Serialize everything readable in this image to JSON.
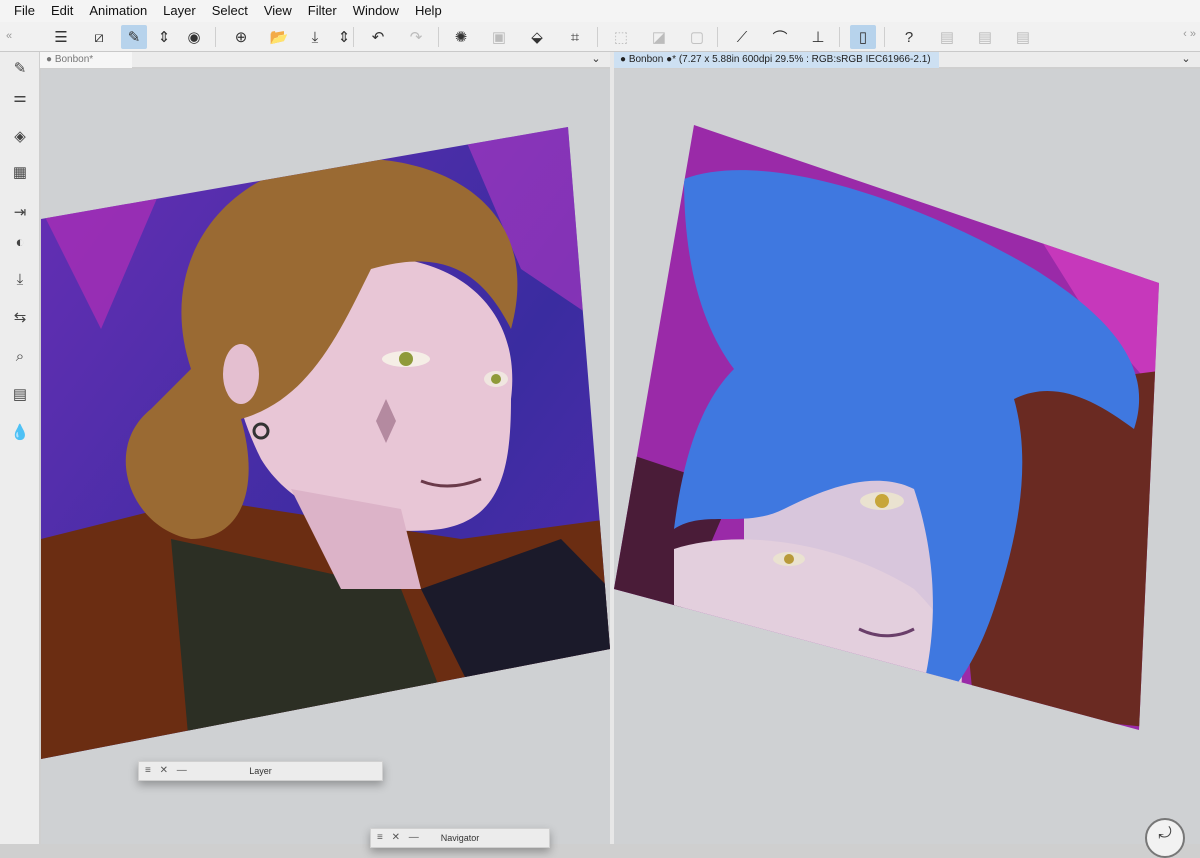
{
  "menubar": {
    "items": [
      {
        "id": "file",
        "label": "File"
      },
      {
        "id": "edit",
        "label": "Edit"
      },
      {
        "id": "animation",
        "label": "Animation"
      },
      {
        "id": "layer",
        "label": "Layer"
      },
      {
        "id": "select",
        "label": "Select"
      },
      {
        "id": "view",
        "label": "View"
      },
      {
        "id": "filter",
        "label": "Filter"
      },
      {
        "id": "window",
        "label": "Window"
      },
      {
        "id": "help",
        "label": "Help"
      }
    ]
  },
  "toolbar": {
    "buttons": [
      {
        "icon": "hamburger-menu-icon",
        "glyph": "☰",
        "active": false,
        "disabled": false
      },
      {
        "icon": "canvas-resize-icon",
        "glyph": "⧄",
        "active": false,
        "disabled": false
      },
      {
        "icon": "edit-tool-icon",
        "glyph": "✎",
        "active": true,
        "disabled": false
      },
      {
        "icon": "up-down-arrows-icon",
        "glyph": "⇕",
        "active": false,
        "disabled": false
      },
      {
        "icon": "record-icon",
        "glyph": "◉",
        "active": false,
        "disabled": false
      },
      {
        "icon": "new-canvas-icon",
        "glyph": "⊕",
        "active": false,
        "disabled": false
      },
      {
        "icon": "open-folder-icon",
        "glyph": "📂",
        "active": false,
        "disabled": false
      },
      {
        "icon": "save-icon",
        "glyph": "⤓",
        "active": false,
        "disabled": false
      },
      {
        "icon": "up-down-arrows-icon",
        "glyph": "⇕",
        "active": false,
        "disabled": false
      },
      {
        "icon": "undo-icon",
        "glyph": "↶",
        "active": false,
        "disabled": false
      },
      {
        "icon": "redo-icon",
        "glyph": "↷",
        "active": false,
        "disabled": true
      },
      {
        "icon": "loading-spinner-icon",
        "glyph": "✺",
        "active": false,
        "disabled": false
      },
      {
        "icon": "select-all-icon",
        "glyph": "▣",
        "active": false,
        "disabled": true
      },
      {
        "icon": "fill-bucket-icon",
        "glyph": "⬙",
        "active": false,
        "disabled": false
      },
      {
        "icon": "crop-icon",
        "glyph": "⌗",
        "active": false,
        "disabled": false
      },
      {
        "icon": "deselect-icon",
        "glyph": "⬚",
        "active": false,
        "disabled": true
      },
      {
        "icon": "invert-selection-icon",
        "glyph": "◪",
        "active": false,
        "disabled": true
      },
      {
        "icon": "selection-border-icon",
        "glyph": "▢",
        "active": false,
        "disabled": true
      },
      {
        "icon": "ruler-pen-icon",
        "glyph": "⟋",
        "active": false,
        "disabled": false
      },
      {
        "icon": "brush-icon",
        "glyph": "⌒",
        "active": false,
        "disabled": false
      },
      {
        "icon": "straight-line-icon",
        "glyph": "⊥",
        "active": false,
        "disabled": false
      },
      {
        "icon": "device-icon",
        "glyph": "▯",
        "active": true,
        "disabled": false
      },
      {
        "icon": "help-icon",
        "glyph": "?",
        "active": false,
        "disabled": false
      },
      {
        "icon": "clipboard-icon",
        "glyph": "▤",
        "active": false,
        "disabled": true
      },
      {
        "icon": "clipboard-icon",
        "glyph": "▤",
        "active": false,
        "disabled": true
      },
      {
        "icon": "clipboard-icon",
        "glyph": "▤",
        "active": false,
        "disabled": true
      }
    ]
  },
  "sidebar": {
    "top_arrows": [
      "«",
      "›"
    ],
    "right_arrows": "‹ »",
    "tools": [
      {
        "icon": "pen-tool-icon",
        "glyph": "✎"
      },
      {
        "icon": "sliders-icon",
        "glyph": "⚌"
      },
      {
        "icon": "layers-icon",
        "glyph": "◈"
      },
      {
        "icon": "film-strip-icon",
        "glyph": "▦"
      },
      {
        "icon": "animation-cel-icon",
        "glyph": "⇥"
      },
      {
        "icon": "color-wheel-icon",
        "glyph": "◐"
      },
      {
        "icon": "import-icon",
        "glyph": "⤓"
      },
      {
        "icon": "transform-icon",
        "glyph": "⇆"
      },
      {
        "icon": "search-zoom-icon",
        "glyph": "⌕"
      },
      {
        "icon": "panel-icon",
        "glyph": "▤"
      },
      {
        "icon": "ink-drops-icon",
        "glyph": "💧"
      }
    ]
  },
  "left_pane": {
    "tab": {
      "dot": "●",
      "title": "Bonbon*"
    },
    "menu_glyph": "⌄"
  },
  "right_pane": {
    "tab": {
      "dot": "●",
      "title": "Bonbon",
      "status_icon": "●*",
      "info": "(7.27 x 5.88in 600dpi 29.5% : RGB:sRGB IEC61966-2.1)"
    },
    "menu_glyph": "⌄"
  },
  "panels": {
    "layer": {
      "controls": "≡ ✕ —",
      "title": "Layer"
    },
    "navigator": {
      "controls": "≡ ✕ —",
      "title": "Navigator"
    }
  },
  "corner_button": {
    "glyph": "⤾"
  },
  "colors": {
    "accent": "#b7d3ec",
    "tab_active": "#cde0f2",
    "canvas_bg": "#cfd1d3",
    "art_left_bg": "#6a2fb6",
    "art_right_bg": "#9a2aa8",
    "hair_left": "#9a6a33",
    "hair_right": "#3f78e0"
  }
}
